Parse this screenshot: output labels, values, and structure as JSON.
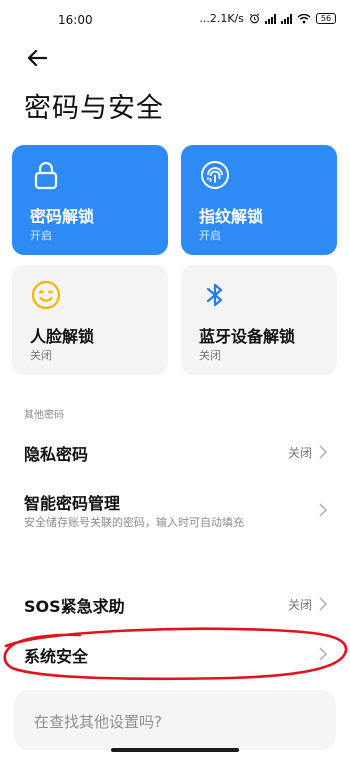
{
  "status_bar": {
    "time": "16:00",
    "network_speed": "...2.1K/s",
    "battery": "56",
    "icons": [
      "alarm-icon",
      "signal-icon",
      "signal-icon",
      "wifi-icon",
      "battery-icon"
    ]
  },
  "header": {
    "title": "密码与安全"
  },
  "cards": [
    {
      "title": "密码解锁",
      "status": "开启",
      "icon": "lock-icon",
      "style": "blue"
    },
    {
      "title": "指纹解锁",
      "status": "开启",
      "icon": "fingerprint-icon",
      "style": "blue"
    },
    {
      "title": "人脸解锁",
      "status": "关闭",
      "icon": "face-icon",
      "style": "gray"
    },
    {
      "title": "蓝牙设备解锁",
      "status": "关闭",
      "icon": "bluetooth-icon",
      "style": "gray"
    }
  ],
  "other_section": {
    "label": "其他密码",
    "items": [
      {
        "title": "隐私密码",
        "value": "关闭"
      },
      {
        "title": "智能密码管理",
        "subtitle": "安全储存账号关联的密码，输入时可自动填充"
      },
      {
        "title": "SOS紧急求助",
        "value": "关闭"
      },
      {
        "title": "系统安全"
      }
    ]
  },
  "search_prompt": "在查找其他设置吗?",
  "colors": {
    "accent_blue": "#2e8bf5",
    "annotation_red": "#e0141e",
    "card_gray": "#f4f4f4"
  }
}
